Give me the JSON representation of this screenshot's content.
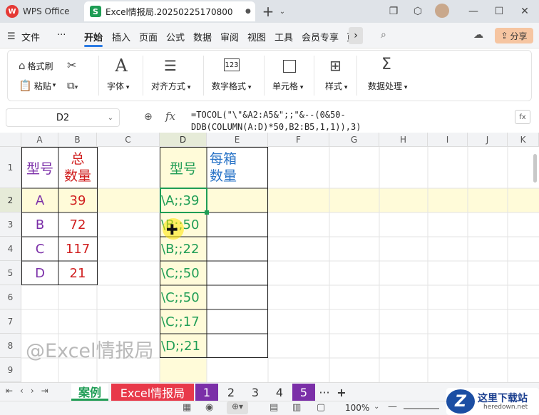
{
  "window": {
    "app_tab": "WPS Office",
    "file_tab": "Excel情报局.20250225170800",
    "tab_dot": "●",
    "new_tab": "+"
  },
  "menu": {
    "file": "文件",
    "more": "···",
    "items": [
      "开始",
      "插入",
      "页面",
      "公式",
      "数据",
      "审阅",
      "视图",
      "工具",
      "会员专享",
      "页"
    ],
    "share": "分享"
  },
  "ribbon": {
    "format_painter": "格式刷",
    "paste": "粘贴",
    "font": "字体",
    "align": "对齐方式",
    "number_format": "数字格式",
    "cell": "单元格",
    "style": "样式",
    "data_process": "数据处理"
  },
  "formula_bar": {
    "name_box": "D2",
    "fx": "fx",
    "formula_line1": "=TOCOL(\"\\\"&A2:A5&\";;\"&--(0&50-",
    "formula_line2": "DDB(COLUMN(A:D)*50,B2:B5,1,1)),3)"
  },
  "columns": [
    "A",
    "B",
    "C",
    "D",
    "E",
    "F",
    "G",
    "H",
    "I",
    "J",
    "K"
  ],
  "rows": [
    "1",
    "2",
    "3",
    "4",
    "5",
    "6",
    "7",
    "8",
    "9"
  ],
  "table": {
    "header_model": "型号",
    "header_qty_line1": "总",
    "header_qty_line2": "数量",
    "models": [
      "A",
      "B",
      "C",
      "D"
    ],
    "quantities": [
      "39",
      "72",
      "117",
      "21"
    ]
  },
  "result": {
    "header": "型号",
    "header_e_line1": "每箱",
    "header_e_line2": "数量",
    "values": [
      "\\A;;39",
      "\\B;;50",
      "\\B;;22",
      "\\C;;50",
      "\\C;;50",
      "\\C;;17",
      "\\D;;21"
    ]
  },
  "watermark": "@Excel情报局",
  "sheets": {
    "active": "案例",
    "tabs": [
      "Excel情报局",
      "1",
      "2",
      "3",
      "4",
      "5"
    ],
    "more": "···",
    "add": "+"
  },
  "status": {
    "zoom": "100%"
  },
  "brand": {
    "name": "这里下载站",
    "url": "heredown.net"
  },
  "colors": {
    "accent": "#2b7be4",
    "model_purple": "#7b2fa8",
    "qty_red": "#d01f1f",
    "result_green": "#1f9d55",
    "header_blue": "#2a74c7",
    "highlight_yellow": "#fffbd9"
  }
}
